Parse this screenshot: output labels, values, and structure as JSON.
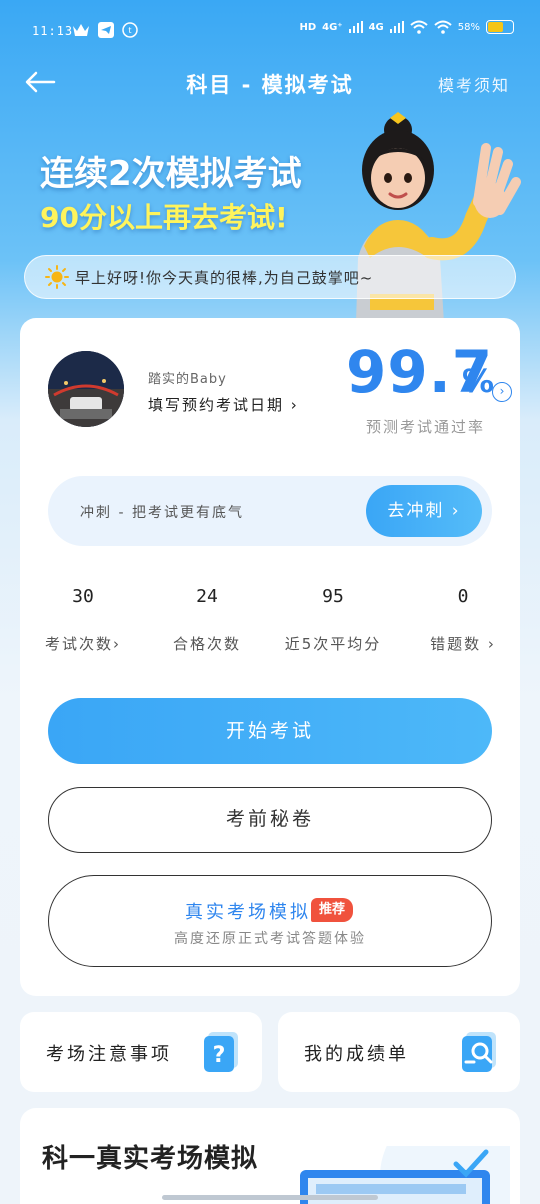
{
  "status_bar": {
    "time": "11:13",
    "battery": "58%",
    "network_1": "4G⁺",
    "network_2": "4G",
    "hd_label": "HD"
  },
  "header": {
    "title": "科目 - 模拟考试",
    "notice_link": "模考须知"
  },
  "banner": {
    "line1": "连续2次模拟考试",
    "line2": "90分以上再去考试!"
  },
  "greeting": {
    "icon": "sun-icon",
    "text": "早上好呀!你今天真的很棒,为自己鼓掌吧~"
  },
  "profile": {
    "user_name": "踏实的Baby",
    "date_link": "填写预约考试日期 ›"
  },
  "pass_rate": {
    "value": "99.7",
    "unit": "%",
    "label": "预测考试通过率",
    "arrow": "›"
  },
  "sprint": {
    "text": "冲刺 - 把考试更有底气",
    "button": "去冲刺 ›"
  },
  "stats": [
    {
      "value": "30",
      "label": "考试次数›"
    },
    {
      "value": "24",
      "label": "合格次数"
    },
    {
      "value": "95",
      "label": "近5次平均分"
    },
    {
      "value": "0",
      "label": "错题数 ›"
    }
  ],
  "actions": {
    "start": "开始考试",
    "secret": "考前秘卷",
    "real_title": "真实考场模拟",
    "real_badge": "推荐",
    "real_sub": "高度还原正式考试答题体验"
  },
  "cards": {
    "notice": "考场注意事项",
    "scores": "我的成绩单"
  },
  "bottom": {
    "title": "科一真实考场模拟"
  },
  "colors": {
    "accent": "#2f86ee",
    "button_blue": "#3aa6f6",
    "badge_red": "#f0523d",
    "banner_yellow": "#fff45c"
  }
}
